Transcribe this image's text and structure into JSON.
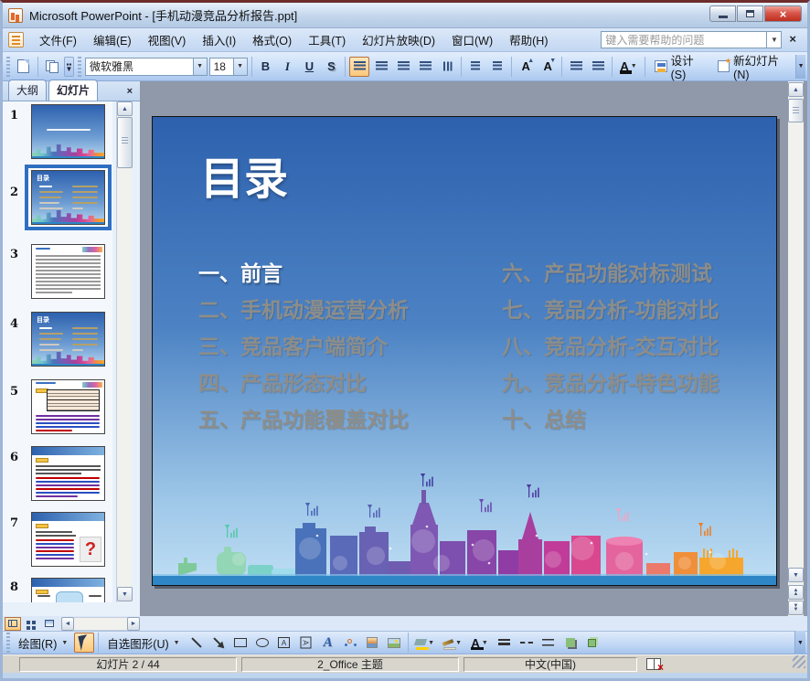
{
  "window": {
    "title": "Microsoft PowerPoint - [手机动漫竞品分析报告.ppt]"
  },
  "menu": {
    "items": [
      "文件(F)",
      "编辑(E)",
      "视图(V)",
      "插入(I)",
      "格式(O)",
      "工具(T)",
      "幻灯片放映(D)",
      "窗口(W)",
      "帮助(H)"
    ],
    "help_placeholder": "键入需要帮助的问题"
  },
  "toolbar": {
    "font_name": "微软雅黑",
    "font_size": "18",
    "bold": "B",
    "italic": "I",
    "underline": "U",
    "shadow": "S",
    "font_color_letter": "A",
    "increase_font_letter": "A",
    "decrease_font_letter": "A",
    "design": "设计(S)",
    "new_slide": "新幻灯片(N)"
  },
  "panel": {
    "tab_outline": "大纲",
    "tab_slides": "幻灯片",
    "thumbnails": [
      {
        "number": "1"
      },
      {
        "number": "2"
      },
      {
        "number": "3"
      },
      {
        "number": "4"
      },
      {
        "number": "5"
      },
      {
        "number": "6"
      },
      {
        "number": "7"
      },
      {
        "number": "8"
      }
    ],
    "selected_slide": "2"
  },
  "slide": {
    "title": "目录",
    "toc_left": [
      "一、前言",
      "二、手机动漫运营分析",
      "三、竞品客户端简介",
      "四、产品形态对比",
      "五、产品功能覆盖对比"
    ],
    "toc_right": [
      "六、产品功能对标测试",
      "七、竞品分析-功能对比",
      "八、竞品分析-交互对比",
      "九、竞品分析-特色功能",
      "十、总结"
    ]
  },
  "drawbar": {
    "draw": "绘图(R)",
    "autoshapes": "自选图形(U)"
  },
  "statusbar": {
    "slide_info": "幻灯片 2 / 44",
    "theme_name": "2_Office 主题",
    "language": "中文(中国)"
  },
  "colors": {
    "slide_gradient_top": "#2d61ae",
    "slide_gradient_bottom": "#bfdef4",
    "toc_active_text": "#ffffff",
    "toc_dim_text": "#8d8d89",
    "water_bar": "#2e86c6",
    "selection_border": "#2f6fc1",
    "active_button_bg": "#fbc87c",
    "close_button": "#be2e1f",
    "skyline_palette": [
      "#8fd4b4",
      "#7cd2c8",
      "#4a72ba",
      "#6961b4",
      "#7e58b2",
      "#a83f9e",
      "#c03c98",
      "#d9478f",
      "#e4649e",
      "#f08f3a",
      "#f6a62c"
    ]
  }
}
